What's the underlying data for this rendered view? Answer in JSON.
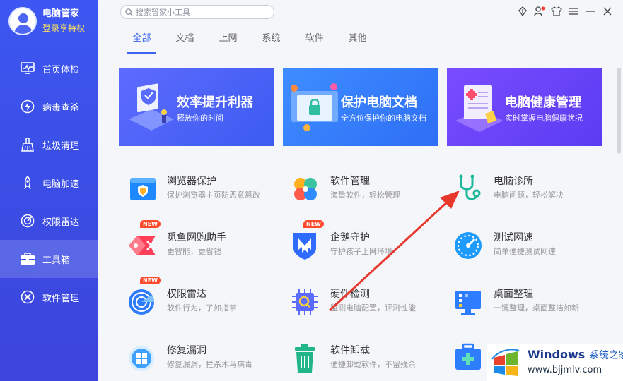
{
  "profile": {
    "name": "电脑管家",
    "vip": "登录享特权"
  },
  "sidebar": {
    "items": [
      {
        "label": "首页体检",
        "icon": "monitor-icon"
      },
      {
        "label": "病毒查杀",
        "icon": "lightning-icon"
      },
      {
        "label": "垃圾清理",
        "icon": "broom-icon"
      },
      {
        "label": "电脑加速",
        "icon": "rocket-icon"
      },
      {
        "label": "权限雷达",
        "icon": "radar-icon"
      },
      {
        "label": "工具箱",
        "icon": "toolbox-icon",
        "active": true
      },
      {
        "label": "软件管理",
        "icon": "apps-icon"
      }
    ]
  },
  "search": {
    "placeholder": "搜索管家小工具"
  },
  "tabs": [
    {
      "label": "全部",
      "active": true
    },
    {
      "label": "文档"
    },
    {
      "label": "上网"
    },
    {
      "label": "系统"
    },
    {
      "label": "软件"
    },
    {
      "label": "其他"
    }
  ],
  "banners": [
    {
      "title": "效率提升利器",
      "subtitle": "释放你的时间"
    },
    {
      "title": "保护电脑文档",
      "subtitle": "全方位保护你的电脑文档"
    },
    {
      "title": "电脑健康管理",
      "subtitle": "实时掌握电脑健康状况"
    }
  ],
  "tools": [
    {
      "title": "浏览器保护",
      "desc": "保护浏览器主页防恶意篡改",
      "icon": "browser-shield-icon"
    },
    {
      "title": "软件管理",
      "desc": "海量软件，轻松管理",
      "icon": "software-manager-icon"
    },
    {
      "title": "电脑诊所",
      "desc": "电脑问题，轻松解决",
      "icon": "stethoscope-icon"
    },
    {
      "title": "觅鱼网购助手",
      "desc": "更智能，更省钱",
      "icon": "fish-tag-icon",
      "badge": "NEW"
    },
    {
      "title": "企鹅守护",
      "desc": "守护孩子上网环境",
      "icon": "penguin-guard-icon",
      "badge": "NEW"
    },
    {
      "title": "测试网速",
      "desc": "简单便捷测试网速",
      "icon": "speedometer-icon"
    },
    {
      "title": "权限雷达",
      "desc": "软件行为，了如指掌",
      "icon": "radar-icon",
      "badge": "NEW"
    },
    {
      "title": "硬件检测",
      "desc": "监测电脑配置，评测性能",
      "icon": "chip-search-icon"
    },
    {
      "title": "桌面整理",
      "desc": "一键整理，桌面整洁如新",
      "icon": "desktop-icon"
    },
    {
      "title": "修复漏洞",
      "desc": "修复漏洞，拦杀木马病毒",
      "icon": "windows-repair-icon"
    },
    {
      "title": "软件卸载",
      "desc": "便捷卸载软件，不留残余",
      "icon": "trash-icon"
    },
    {
      "title": "",
      "desc": "",
      "icon": "medical-kit-icon"
    }
  ],
  "watermark": {
    "brand": "Windows",
    "brand_suffix": "系统之家",
    "url": "www.bjjmlv.com"
  },
  "colors": {
    "sidebar": "#3c4fe8",
    "accent": "#3b63f0",
    "badge": "#ff4b2b",
    "arrow": "#e8372c"
  }
}
